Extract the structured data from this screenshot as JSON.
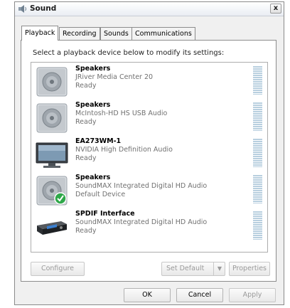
{
  "window": {
    "title": "Sound",
    "close_label": "x"
  },
  "tabs": [
    {
      "label": "Playback"
    },
    {
      "label": "Recording"
    },
    {
      "label": "Sounds"
    },
    {
      "label": "Communications"
    }
  ],
  "instruction": "Select a playback device below to modify its settings:",
  "devices": [
    {
      "name": "Speakers",
      "description": "JRiver Media Center 20",
      "status": "Ready",
      "icon": "speaker-icon"
    },
    {
      "name": "Speakers",
      "description": "McIntosh-HD HS USB Audio",
      "status": "Ready",
      "icon": "speaker-icon"
    },
    {
      "name": "EA273WM-1",
      "description": "NVIDIA High Definition Audio",
      "status": "Ready",
      "icon": "monitor-icon"
    },
    {
      "name": "Speakers",
      "description": "SoundMAX Integrated Digital HD Audio",
      "status": "Default Device",
      "icon": "speaker-default-icon"
    },
    {
      "name": "SPDIF Interface",
      "description": "SoundMAX Integrated Digital HD Audio",
      "status": "Ready",
      "icon": "spdif-receiver-icon"
    }
  ],
  "buttons": {
    "configure": "Configure",
    "set_default": "Set Default",
    "properties": "Properties",
    "ok": "OK",
    "cancel": "Cancel",
    "apply": "Apply"
  },
  "colors": {
    "meter": "#b8cfdf",
    "default_check": "#2fa84a"
  }
}
